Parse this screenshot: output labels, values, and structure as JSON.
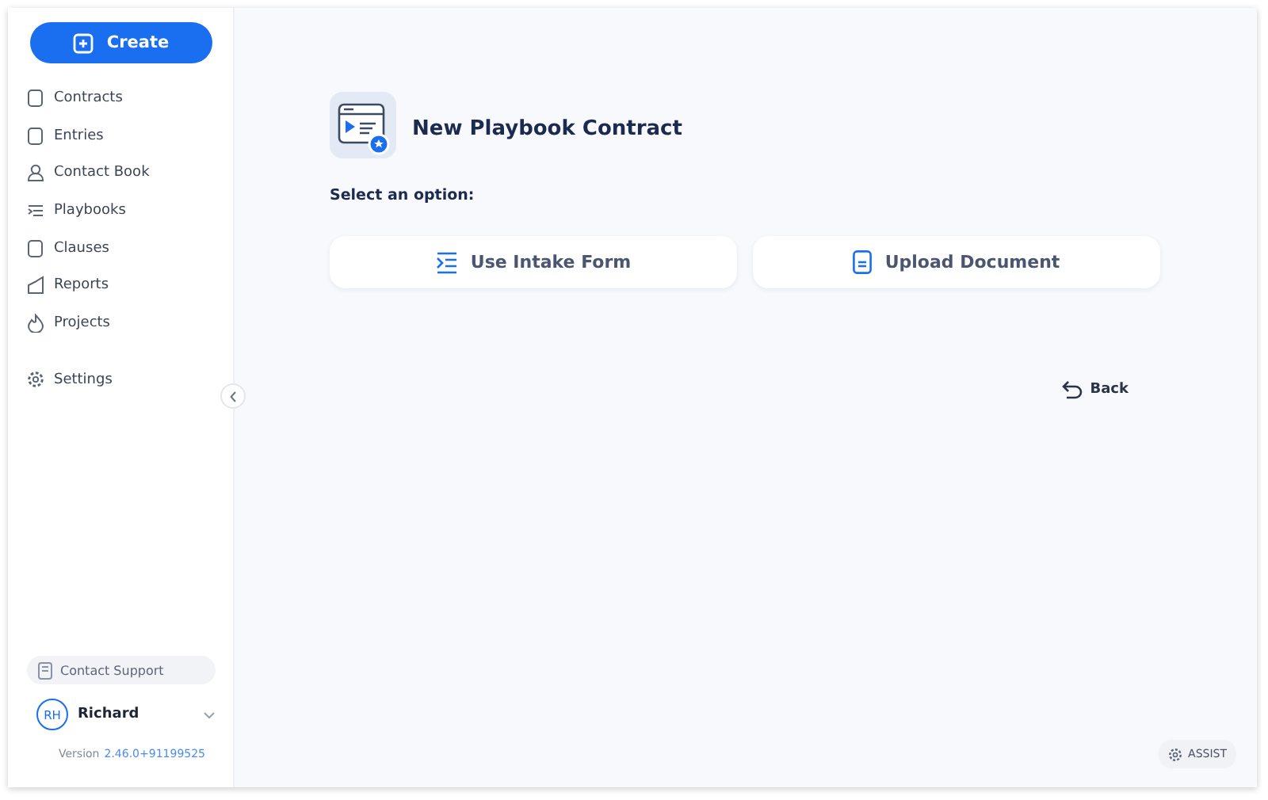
{
  "sidebar": {
    "create_button": "Create",
    "items": [
      {
        "label": "Contracts"
      },
      {
        "label": "Entries"
      },
      {
        "label": "Contact Book"
      },
      {
        "label": "Playbooks"
      },
      {
        "label": "Clauses"
      },
      {
        "label": "Reports"
      },
      {
        "label": "Projects"
      }
    ],
    "settings": "Settings",
    "contact_support": "Contact Support",
    "user": {
      "initials": "RH",
      "name": "Richard"
    },
    "version_label": "Version",
    "version": "2.46.0+91199525"
  },
  "main": {
    "title": "New Playbook Contract",
    "prompt": "Select an option:",
    "options": [
      {
        "label": "Use Intake Form"
      },
      {
        "label": "Upload Document"
      }
    ],
    "back": "Back",
    "assist": "ASSIST"
  }
}
